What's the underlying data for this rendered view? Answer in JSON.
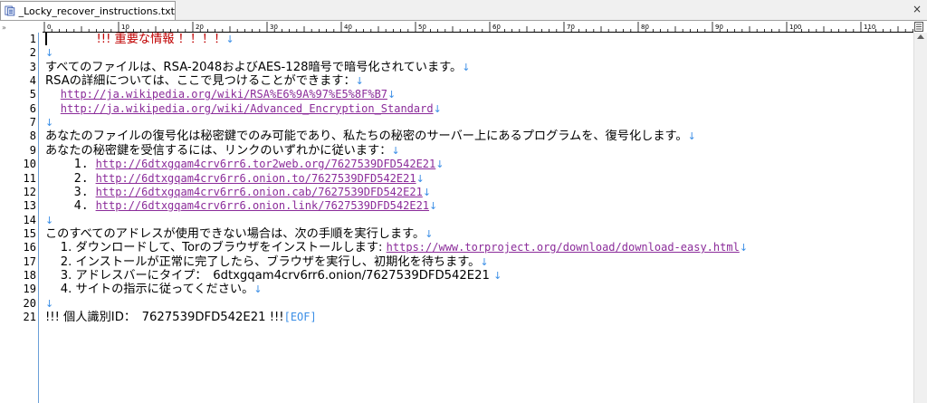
{
  "tab": {
    "title": "_Locky_recover_instructions.txt",
    "close_label": "×"
  },
  "ruler": {
    "labels": [
      "0",
      "10",
      "20",
      "30",
      "40",
      "50",
      "60",
      "70",
      "80",
      "90",
      "100",
      "110"
    ]
  },
  "colors": {
    "link": "#8b2c9a",
    "arrow": "#3a8ee6",
    "red": "#c00000",
    "gutter_line": "#6a9fd8"
  },
  "lines": [
    {
      "n": "1",
      "segments": [
        {
          "t": "!!! 重要な情報 ！！！！",
          "c": "red"
        },
        {
          "t": "↓",
          "c": "arrow"
        }
      ]
    },
    {
      "n": "2",
      "segments": [
        {
          "t": "↓",
          "c": "arrow"
        }
      ]
    },
    {
      "n": "3",
      "segments": [
        {
          "t": "すべてのファイルは、RSA-2048およびAES-128暗号で暗号化されています。",
          "c": ""
        },
        {
          "t": "↓",
          "c": "arrow"
        }
      ]
    },
    {
      "n": "4",
      "segments": [
        {
          "t": "RSAの詳細については、ここで見つけることができます：",
          "c": ""
        },
        {
          "t": "↓",
          "c": "arrow"
        }
      ]
    },
    {
      "n": "5",
      "segments": [
        {
          "t": "    ",
          "c": ""
        },
        {
          "t": "http://ja.wikipedia.org/wiki/RSA%E6%9A%97%E5%8F%B7",
          "c": "link"
        },
        {
          "t": "↓",
          "c": "arrow"
        }
      ]
    },
    {
      "n": "6",
      "segments": [
        {
          "t": "    ",
          "c": ""
        },
        {
          "t": "http://ja.wikipedia.org/wiki/Advanced_Encryption_Standard",
          "c": "link"
        },
        {
          "t": "↓",
          "c": "arrow"
        }
      ]
    },
    {
      "n": "7",
      "segments": [
        {
          "t": "↓",
          "c": "arrow"
        }
      ]
    },
    {
      "n": "8",
      "segments": [
        {
          "t": "あなたのファイルの復号化は秘密鍵でのみ可能であり、私たちの秘密のサーバー上にあるプログラムを、復号化します。",
          "c": ""
        },
        {
          "t": "↓",
          "c": "arrow"
        }
      ]
    },
    {
      "n": "9",
      "segments": [
        {
          "t": "あなたの秘密鍵を受信するには、リンクのいずれかに従います：",
          "c": ""
        },
        {
          "t": "↓",
          "c": "arrow"
        }
      ]
    },
    {
      "n": "10",
      "segments": [
        {
          "t": "    1. ",
          "c": "mono"
        },
        {
          "t": "http://6dtxgqam4crv6rr6.tor2web.org/7627539DFD542E21",
          "c": "link"
        },
        {
          "t": "↓",
          "c": "arrow"
        }
      ]
    },
    {
      "n": "11",
      "segments": [
        {
          "t": "    2. ",
          "c": "mono"
        },
        {
          "t": "http://6dtxgqam4crv6rr6.onion.to/7627539DFD542E21",
          "c": "link"
        },
        {
          "t": "↓",
          "c": "arrow"
        }
      ]
    },
    {
      "n": "12",
      "segments": [
        {
          "t": "    3. ",
          "c": "mono"
        },
        {
          "t": "http://6dtxgqam4crv6rr6.onion.cab/7627539DFD542E21",
          "c": "link"
        },
        {
          "t": "↓",
          "c": "arrow"
        }
      ]
    },
    {
      "n": "13",
      "segments": [
        {
          "t": "    4. ",
          "c": "mono"
        },
        {
          "t": "http://6dtxgqam4crv6rr6.onion.link/7627539DFD542E21",
          "c": "link"
        },
        {
          "t": "↓",
          "c": "arrow"
        }
      ]
    },
    {
      "n": "14",
      "segments": [
        {
          "t": "↓",
          "c": "arrow"
        }
      ]
    },
    {
      "n": "15",
      "segments": [
        {
          "t": "このすべてのアドレスが使用できない場合は、次の手順を実行します。",
          "c": ""
        },
        {
          "t": "↓",
          "c": "arrow"
        }
      ]
    },
    {
      "n": "16",
      "segments": [
        {
          "t": "    1. ダウンロードして、Torのブラウザをインストールします: ",
          "c": ""
        },
        {
          "t": "https://www.torproject.org/download/download-easy.html",
          "c": "link"
        },
        {
          "t": "↓",
          "c": "arrow"
        }
      ]
    },
    {
      "n": "17",
      "segments": [
        {
          "t": "    2. インストールが正常に完了したら、ブラウザを実行し、初期化を待ちます。",
          "c": ""
        },
        {
          "t": "↓",
          "c": "arrow"
        }
      ]
    },
    {
      "n": "18",
      "segments": [
        {
          "t": "    3. アドレスバーにタイプ：　6dtxgqam4crv6rr6.onion/7627539DFD542E21 ",
          "c": ""
        },
        {
          "t": "↓",
          "c": "arrow"
        }
      ]
    },
    {
      "n": "19",
      "segments": [
        {
          "t": "    4. サイトの指示に従ってください。",
          "c": ""
        },
        {
          "t": "↓",
          "c": "arrow"
        }
      ]
    },
    {
      "n": "20",
      "segments": [
        {
          "t": "↓",
          "c": "arrow"
        }
      ]
    },
    {
      "n": "21",
      "segments": [
        {
          "t": "!!! 個人識別ID：　7627539DFD542E21 !!!",
          "c": ""
        },
        {
          "t": "[EOF]",
          "c": "eof"
        }
      ]
    }
  ]
}
